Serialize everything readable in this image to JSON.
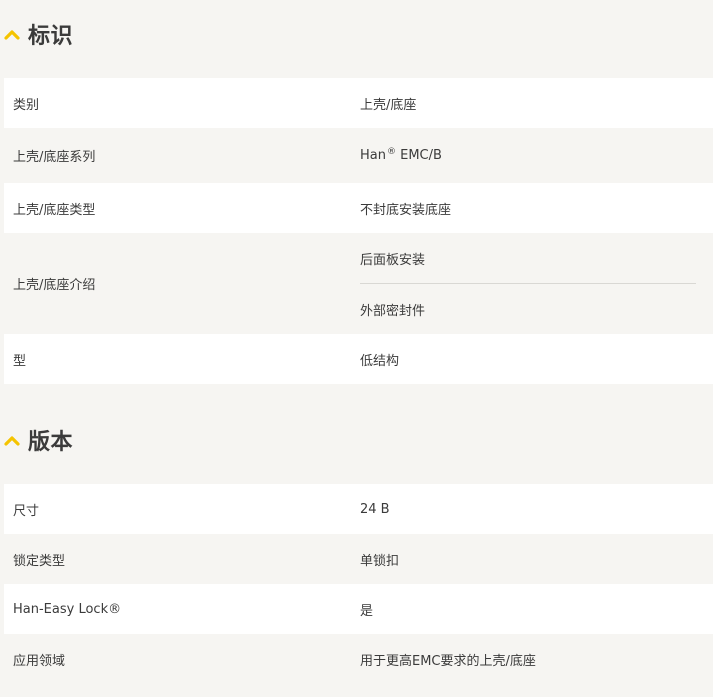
{
  "sections": [
    {
      "title": "标识",
      "rows": [
        {
          "label": "类别",
          "value": "上壳/底座"
        },
        {
          "label": "上壳/底座系列",
          "value_prefix": "Han",
          "value_sup": "®",
          "value_suffix": " EMC/B"
        },
        {
          "label": "上壳/底座类型",
          "value": "不封底安装底座"
        },
        {
          "label": "上壳/底座介绍",
          "values": [
            "后面板安装",
            "外部密封件"
          ]
        },
        {
          "label": "型",
          "value": "低结构"
        }
      ]
    },
    {
      "title": "版本",
      "rows": [
        {
          "label": "尺寸",
          "value": "24 B"
        },
        {
          "label": "锁定类型",
          "value": "单锁扣"
        },
        {
          "label": "Han-Easy Lock®",
          "value": "是"
        },
        {
          "label": "应用领域",
          "value": "用于更高EMC要求的上壳/底座"
        }
      ]
    }
  ],
  "colors": {
    "accent": "#f5c400",
    "row_white": "#ffffff",
    "row_gray": "#f6f5f2",
    "text": "#3b3b3b"
  },
  "icons": {
    "section_toggle": "chevron-up-icon"
  }
}
